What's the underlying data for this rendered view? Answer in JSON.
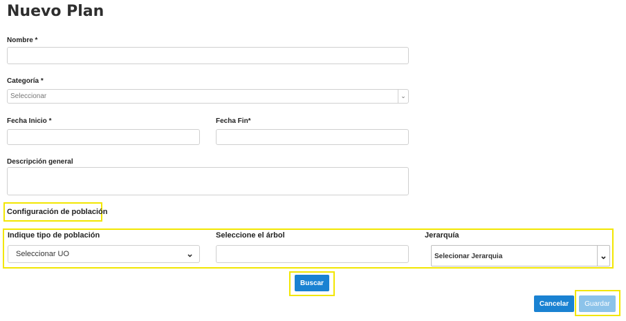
{
  "page": {
    "title": "Nuevo Plan"
  },
  "form": {
    "nombre_label": "Nombre *",
    "nombre_value": "",
    "categoria_label": "Categoría *",
    "categoria_selected": "Seleccionar",
    "fecha_inicio_label": "Fecha Inicio *",
    "fecha_inicio_value": "",
    "fecha_fin_label": "Fecha Fin*",
    "fecha_fin_value": "",
    "descripcion_label": "Descripción general",
    "descripcion_value": ""
  },
  "poblacion": {
    "section_title": "Configuración de población",
    "tipo_label": "Indique tipo de población",
    "tipo_selected": "Seleccionar UO",
    "arbol_label": "Seleccione el árbol",
    "arbol_value": "",
    "jerarquia_label": "Jerarquía",
    "jerarquia_selected": "Selecionar Jerarquia"
  },
  "actions": {
    "buscar_label": "Buscar",
    "cancelar_label": "Cancelar",
    "guardar_label": "Guardar"
  },
  "colors": {
    "primary": "#1a82d2",
    "disabled": "#8cc3ea",
    "highlight": "#f2e600"
  }
}
